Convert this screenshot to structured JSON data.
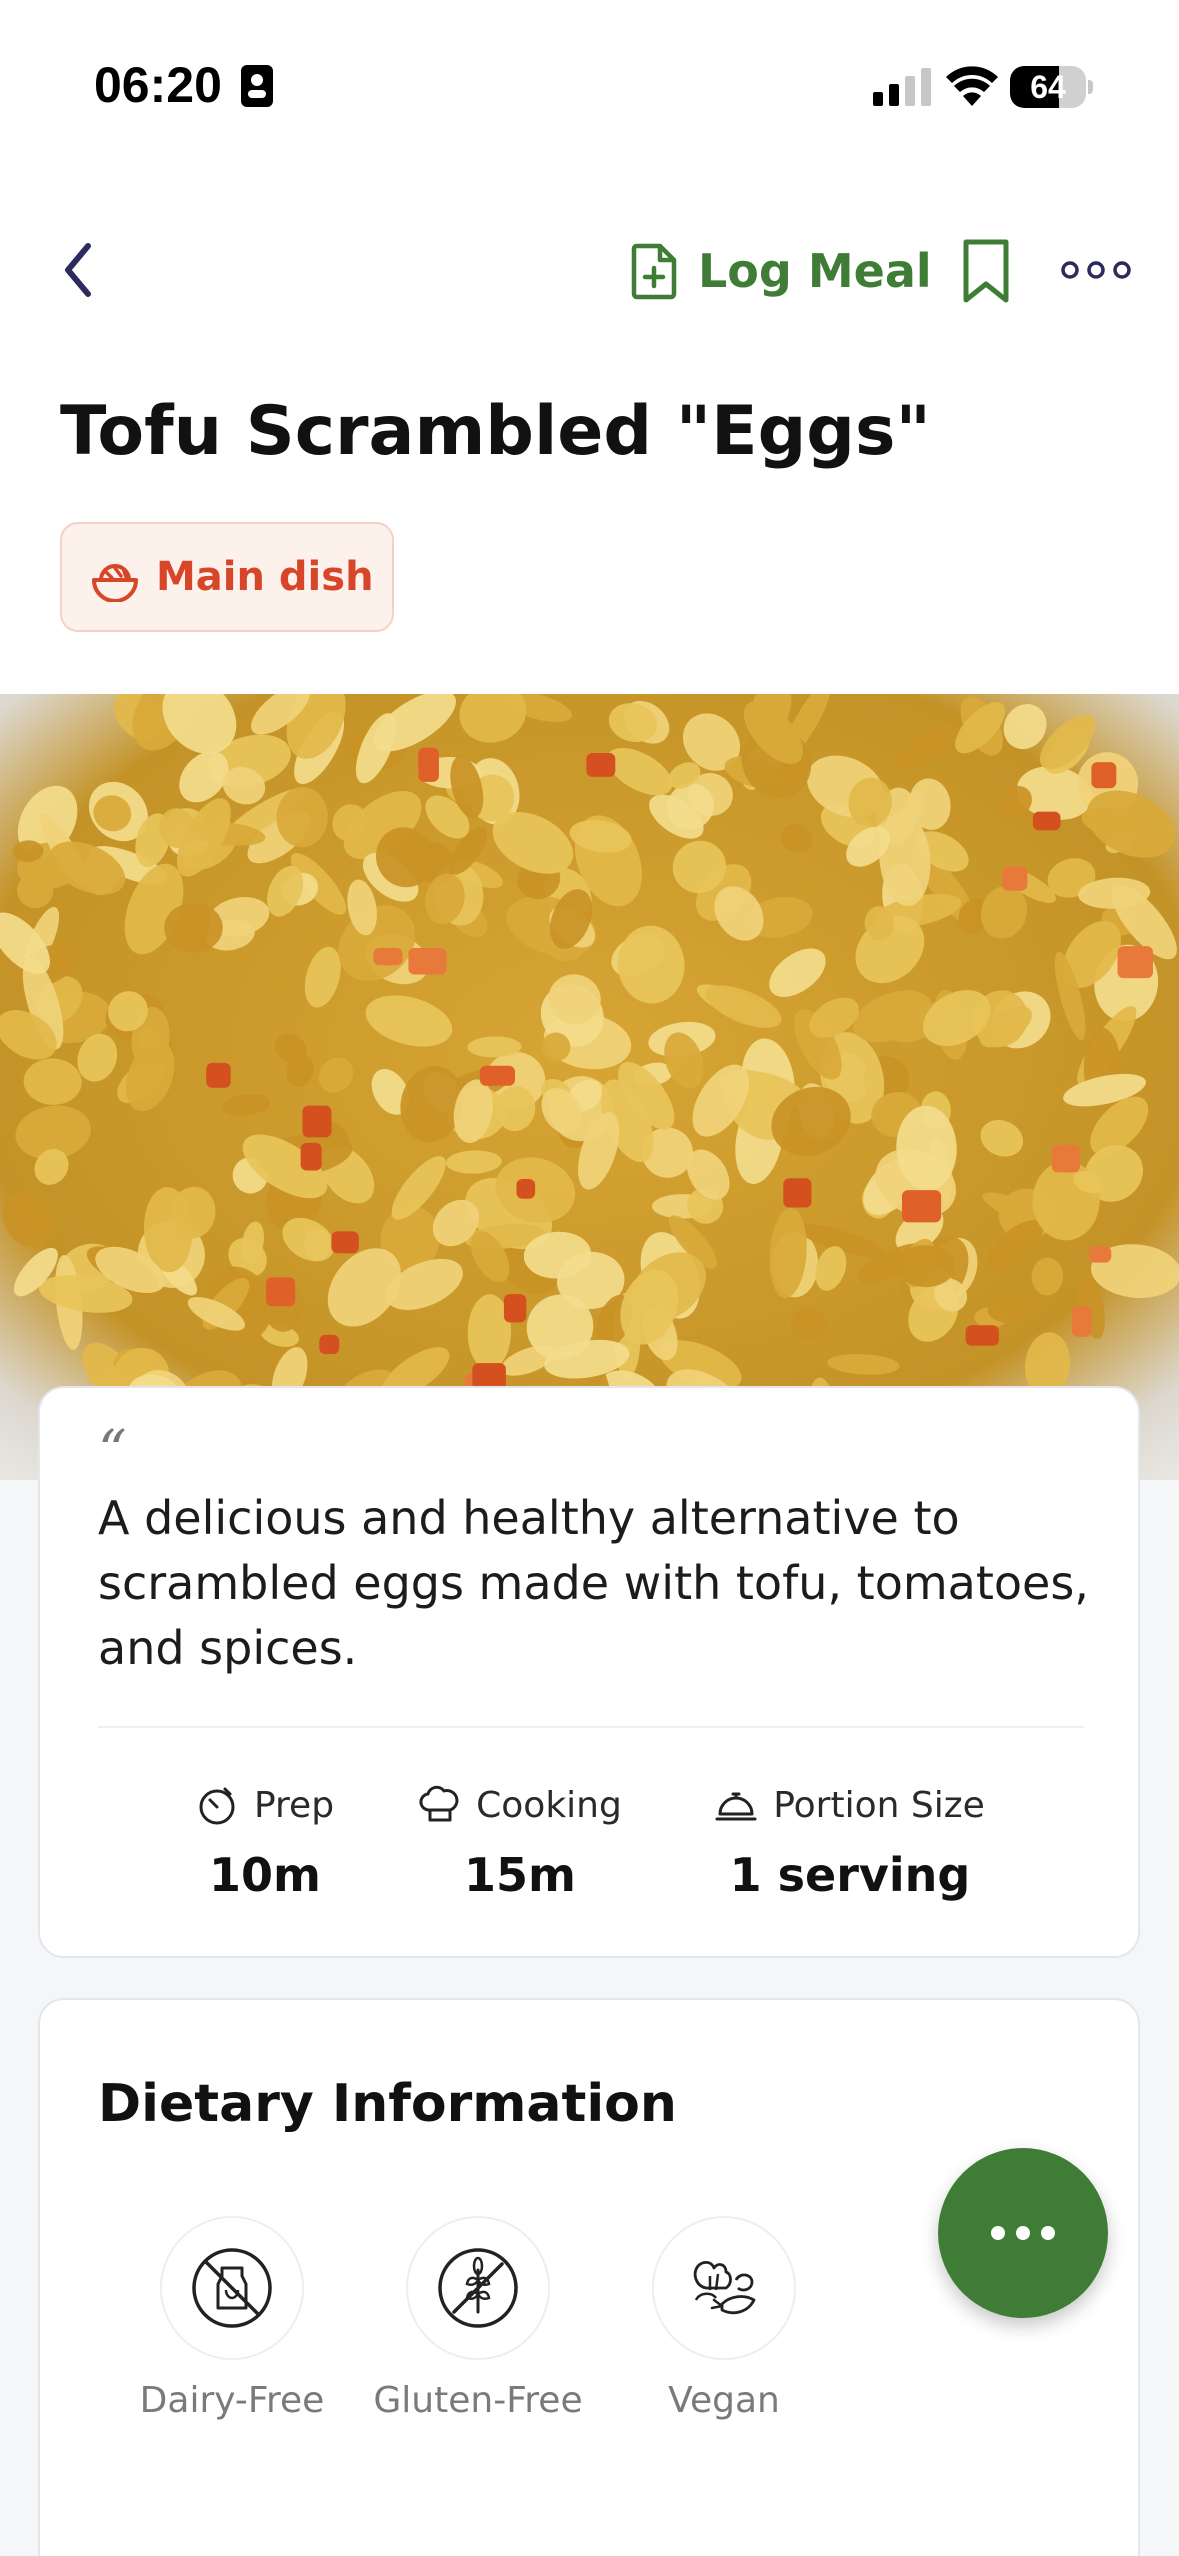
{
  "status_bar": {
    "time": "06:20",
    "battery_percent": "64",
    "battery_level": 0.64
  },
  "nav": {
    "log_meal_label": "Log Meal",
    "back_icon": "chevron-left-icon",
    "log_icon": "file-plus-icon",
    "bookmark_icon": "bookmark-icon",
    "more_icon": "more-horizontal-icon"
  },
  "recipe": {
    "title": "Tofu Scrambled \"Eggs\"",
    "category": "Main dish",
    "category_icon": "dish-icon",
    "description": "A delicious and healthy alternative to scrambled eggs made with tofu, tomatoes, and spices.",
    "quote_mark": "“"
  },
  "stats": {
    "prep": {
      "label": "Prep",
      "value": "10m",
      "icon": "timer-icon"
    },
    "cooking": {
      "label": "Cooking",
      "value": "15m",
      "icon": "chef-hat-icon"
    },
    "portion": {
      "label": "Portion Size",
      "value": "1 serving",
      "icon": "cloche-icon"
    }
  },
  "dietary": {
    "title": "Dietary Information",
    "items": [
      {
        "label": "Dairy-Free",
        "icon": "dairy-free-icon"
      },
      {
        "label": "Gluten-Free",
        "icon": "gluten-free-icon"
      },
      {
        "label": "Vegan",
        "icon": "vegan-icon"
      }
    ]
  },
  "colors": {
    "brand_green": "#3f7d36",
    "badge_red": "#d8462a",
    "badge_bg": "#fdf1ec",
    "nav_dark": "#2d2a5e"
  }
}
